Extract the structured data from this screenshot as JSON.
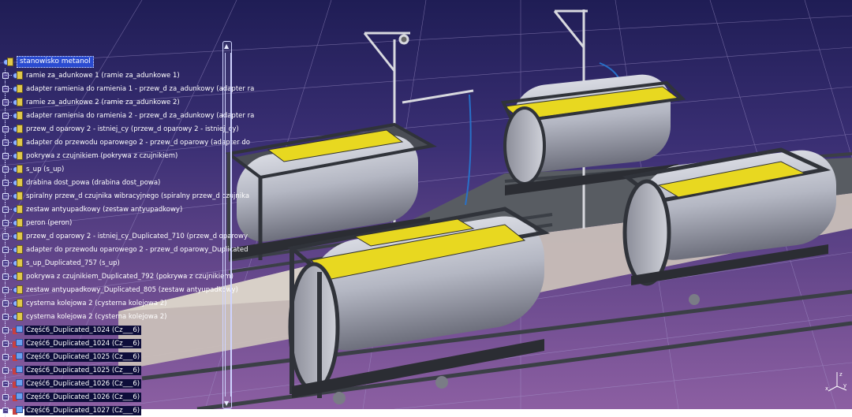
{
  "tree": {
    "root": "stanowisko metanol",
    "items": [
      {
        "label": "ramie za_adunkowe 1 (ramie za_adunkowe 1)",
        "type": "product"
      },
      {
        "label": "adapter ramienia do ramienia 1 - przew_d za_adunkowy (adapter ra",
        "type": "product"
      },
      {
        "label": "ramie za_adunkowe 2 (ramie za_adunkowe 2)",
        "type": "product"
      },
      {
        "label": "adapter ramienia do ramienia 2 - przew_d za_adunkowy (adapter ra",
        "type": "product"
      },
      {
        "label": "przew_d oparowy 2 - istniej_cy (przew_d oparowy 2 - istniej_cy)",
        "type": "product"
      },
      {
        "label": "adapter do przewodu oparowego 2 - przew_d oparowy (adapter do",
        "type": "product"
      },
      {
        "label": "pokrywa z czujnikiem (pokrywa z czujnikiem)",
        "type": "product"
      },
      {
        "label": "s_up (s_up)",
        "type": "product"
      },
      {
        "label": "drabina dost_powa (drabina dost_powa)",
        "type": "product"
      },
      {
        "label": "spiralny przew_d czujnika wibracyjnego (spiralny przew_d czujnika",
        "type": "product"
      },
      {
        "label": "zestaw antyupadkowy (zestaw antyupadkowy)",
        "type": "product"
      },
      {
        "label": "peron (peron)",
        "type": "product"
      },
      {
        "label": "przew_d oparowy 2 - istniej_cy_Duplicated_710 (przew_d oparowy",
        "type": "product"
      },
      {
        "label": "adapter do przewodu oparowego 2 - przew_d oparowy_Duplicated",
        "type": "product"
      },
      {
        "label": "s_up_Duplicated_757 (s_up)",
        "type": "product"
      },
      {
        "label": "pokrywa z czujnikiem_Duplicated_792 (pokrywa z czujnikiem)",
        "type": "product"
      },
      {
        "label": "zestaw antyupadkowy_Duplicated_805 (zestaw antyupadkowy)",
        "type": "product"
      },
      {
        "label": "cysterna kolejowa 2 (cysterna kolejowa 2)",
        "type": "product"
      },
      {
        "label": "cysterna kolejowa 2 (cysterna kolejowa 2)",
        "type": "product"
      },
      {
        "label": "Część6_Duplicated_1024 (Cz___6)",
        "type": "part"
      },
      {
        "label": "Część6_Duplicated_1024 (Cz___6)",
        "type": "part"
      },
      {
        "label": "Część6_Duplicated_1025 (Cz___6)",
        "type": "part"
      },
      {
        "label": "Część6_Duplicated_1025 (Cz___6)",
        "type": "part"
      },
      {
        "label": "Część6_Duplicated_1026 (Cz___6)",
        "type": "part"
      },
      {
        "label": "Część6_Duplicated_1026 (Cz___6)",
        "type": "part"
      },
      {
        "label": "Część6_Duplicated_1027 (Cz___6)",
        "type": "part"
      }
    ]
  },
  "compass": {
    "z_label": "z",
    "x_label": "x",
    "y_label": "y"
  },
  "colors": {
    "selection": "#2a4bd0",
    "tank_hatch": "#e8d820",
    "tank_body": "#b9bcc8",
    "frame": "#3a3d46",
    "platform": "#c8bdb4",
    "background_top": "#1f1d55",
    "background_bottom": "#8c5fa2"
  }
}
